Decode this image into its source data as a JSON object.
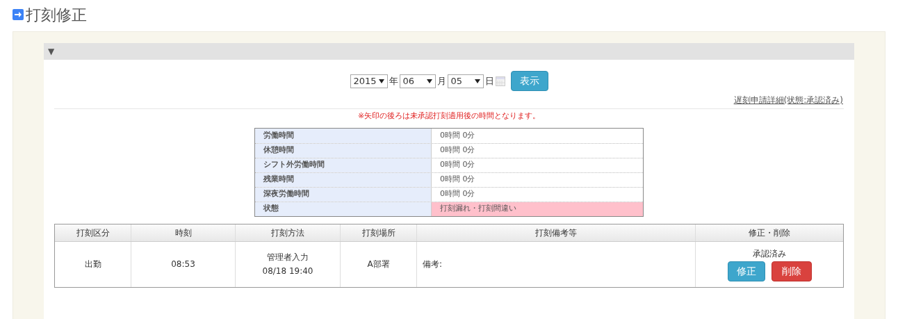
{
  "page_title": "打刻修正",
  "panel": {
    "toggle": "▼"
  },
  "date_picker": {
    "year": "2015",
    "year_unit": "年",
    "month": "06",
    "month_unit": "月",
    "day": "05",
    "day_unit": "日",
    "button": "表示"
  },
  "detail_link": "遅刻申請詳細(状態:承認済み)",
  "notice": "※矢印の後ろは未承認打刻適用後の時間となります。",
  "summary": [
    {
      "label": "労働時間",
      "value": "0時間 0分",
      "alert": false
    },
    {
      "label": "休憩時間",
      "value": "0時間 0分",
      "alert": false
    },
    {
      "label": "シフト外労働時間",
      "value": "0時間 0分",
      "alert": false
    },
    {
      "label": "残業時間",
      "value": "0時間 0分",
      "alert": false
    },
    {
      "label": "深夜労働時間",
      "value": "0時間 0分",
      "alert": false
    },
    {
      "label": "状態",
      "value": "打刻漏れ・打刻間違い",
      "alert": true
    }
  ],
  "table": {
    "columns": [
      "打刻区分",
      "時刻",
      "打刻方法",
      "打刻場所",
      "打刻備考等",
      "修正・削除"
    ],
    "rows": [
      {
        "type": "出勤",
        "time": "08:53",
        "method": [
          "管理者入力",
          "08/18 19:40"
        ],
        "place": "A部署",
        "note": "備考:",
        "status": "承認済み",
        "edit": "修正",
        "delete": "削除"
      }
    ]
  }
}
